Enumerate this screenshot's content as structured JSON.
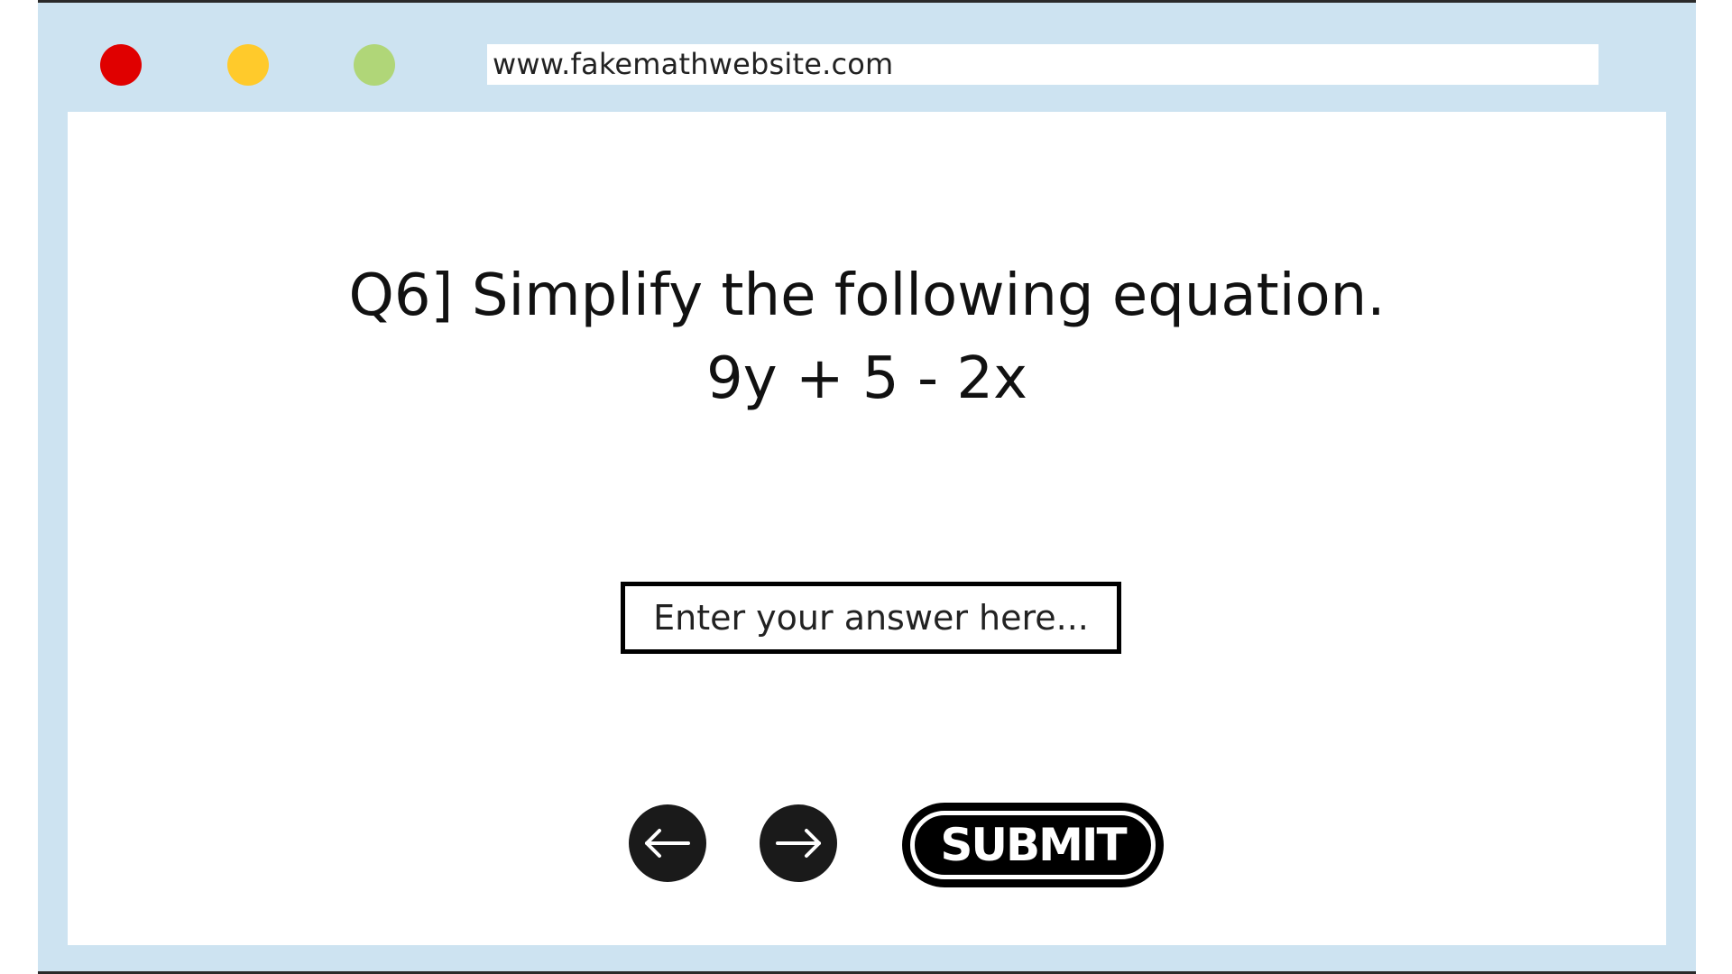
{
  "browser": {
    "controls": [
      {
        "name": "close",
        "color": "#e00000"
      },
      {
        "name": "minimize",
        "color": "#ffca2b"
      },
      {
        "name": "maximize",
        "color": "#b0d678"
      }
    ],
    "url": "www.fakemathwebsite.com",
    "frame_color": "#cde3f1"
  },
  "quiz": {
    "question_title": "Q6] Simplify the following equation.",
    "expression": "9y + 5 - 2x",
    "answer": {
      "value": "",
      "placeholder": "Enter your answer here..."
    },
    "buttons": {
      "prev_icon": "arrow-left-icon",
      "next_icon": "arrow-right-icon",
      "submit_label": "SUBMIT"
    }
  }
}
